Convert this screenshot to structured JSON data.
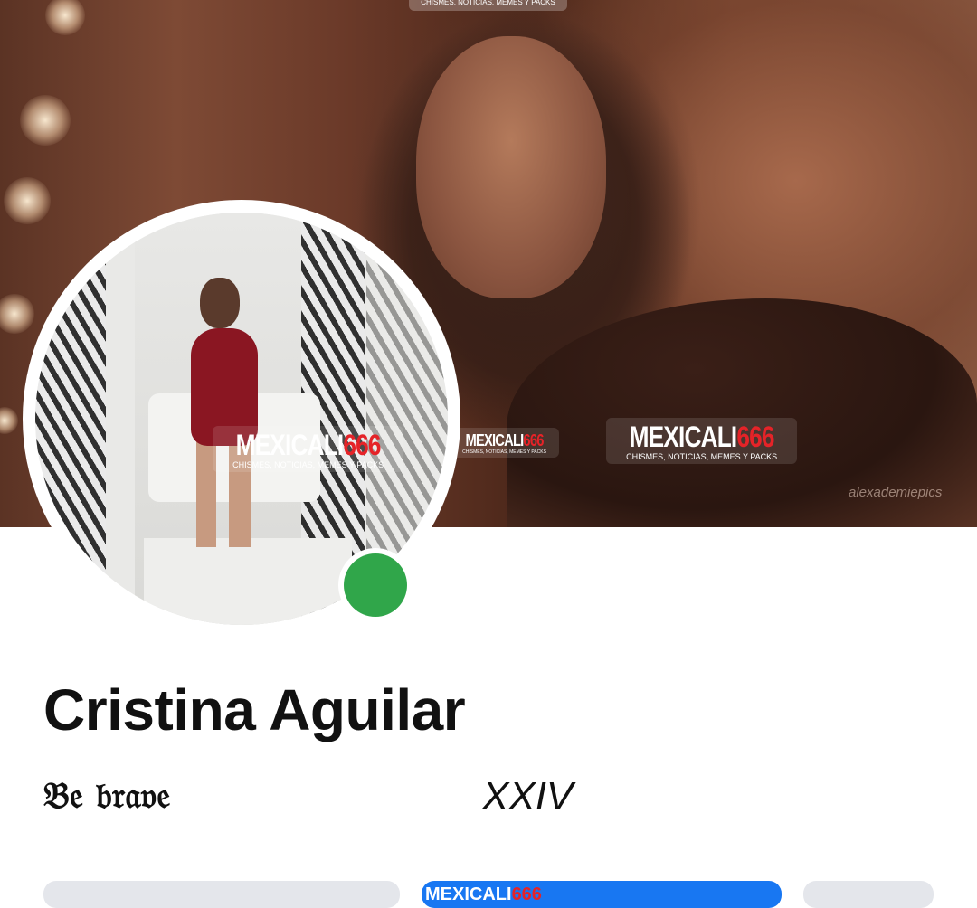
{
  "profile": {
    "name": "Cristina Aguilar",
    "bio_left": "𝔅𝔢 𝔟𝔯𝔞𝔳𝔢",
    "bio_right": "XXIV",
    "online": true
  },
  "cover": {
    "credit": "alexademiepics"
  },
  "watermarks": {
    "brand": "MEXICALI",
    "number": "666",
    "tagline": "CHISMES, NOTICIAS, MEMES Y PACKS"
  },
  "colors": {
    "status_online": "#30a64a",
    "primary_button": "#1877f2",
    "secondary_button": "#e4e6eb",
    "brand_red": "#e52328"
  }
}
